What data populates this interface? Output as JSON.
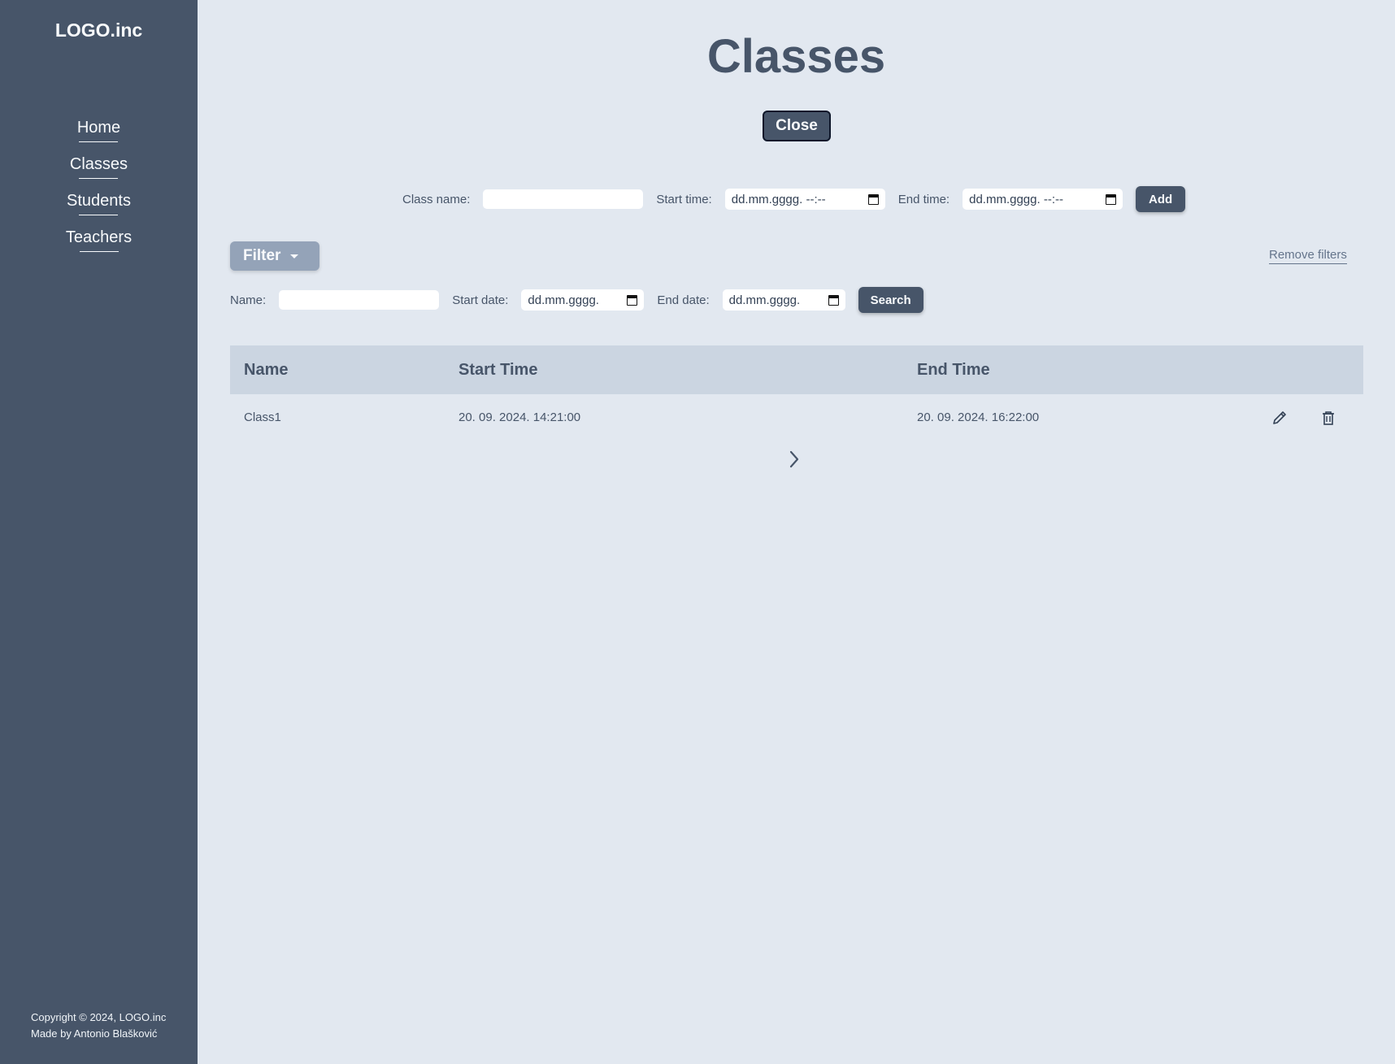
{
  "sidebar": {
    "logo": "LOGO.inc",
    "items": [
      {
        "label": "Home"
      },
      {
        "label": "Classes"
      },
      {
        "label": "Students"
      },
      {
        "label": "Teachers"
      }
    ],
    "footer_line1": "Copyright © 2024, LOGO.inc",
    "footer_line2": "Made by Antonio Blašković"
  },
  "main": {
    "title": "Classes",
    "close_label": "Close",
    "add_form": {
      "class_name_label": "Class name:",
      "class_name_value": "",
      "start_time_label": "Start time:",
      "start_time_placeholder": "dd.mm.gggg. --:--",
      "end_time_label": "End time:",
      "end_time_placeholder": "dd.mm.gggg. --:--",
      "add_label": "Add"
    },
    "filter": {
      "filter_label": "Filter",
      "remove_filters_label": "Remove filters",
      "name_label": "Name:",
      "name_value": "",
      "start_date_label": "Start date:",
      "start_date_placeholder": "dd.mm.gggg.",
      "end_date_label": "End date:",
      "end_date_placeholder": "dd.mm.gggg.",
      "search_label": "Search"
    },
    "table": {
      "headers": [
        "Name",
        "Start Time",
        "End Time"
      ],
      "rows": [
        {
          "name": "Class1",
          "start": "20. 09. 2024. 14:21:00",
          "end": "20. 09. 2024. 16:22:00"
        }
      ]
    },
    "icons": {
      "edit": "pencil-icon",
      "delete": "trash-icon",
      "next_page": "chevron-right-icon",
      "calendar": "calendar-icon"
    }
  }
}
